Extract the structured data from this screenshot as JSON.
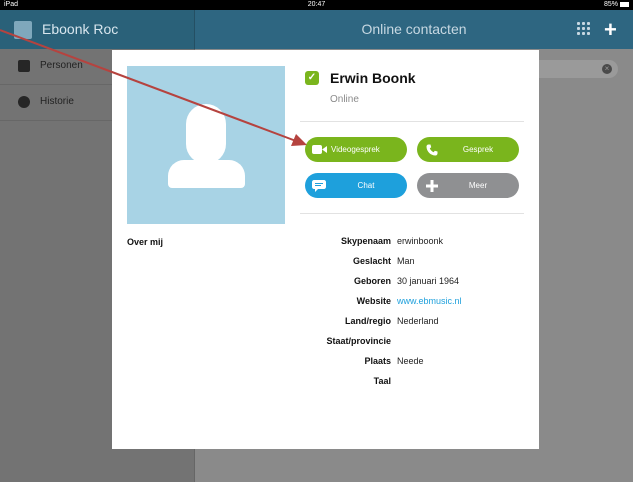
{
  "status_bar": {
    "device": "iPad",
    "time": "20:47",
    "battery": "85%"
  },
  "nav": {
    "user_name": "Eboonk Roc",
    "title": "Online contacten"
  },
  "sidebar": {
    "items": [
      {
        "label": "Personen",
        "icon": "contacts-icon"
      },
      {
        "label": "Historie",
        "icon": "history-clock-icon"
      }
    ]
  },
  "search": {
    "clear_icon": "×"
  },
  "contact": {
    "name": "Erwin Boonk",
    "status": "Online",
    "status_color": "#7ab51d",
    "about_label": "Over mij",
    "actions": {
      "video": "Videogesprek",
      "call": "Gesprek",
      "chat": "Chat",
      "more": "Meer"
    },
    "details": [
      {
        "label": "Skypenaam",
        "value": "erwinboonk"
      },
      {
        "label": "Geslacht",
        "value": "Man"
      },
      {
        "label": "Geboren",
        "value": "30 januari 1964"
      },
      {
        "label": "Website",
        "value": "www.ebmusic.nl"
      },
      {
        "label": "Land/regio",
        "value": "Nederland"
      },
      {
        "label": "Staat/provincie",
        "value": ""
      },
      {
        "label": "Plaats",
        "value": "Neede"
      },
      {
        "label": "Taal",
        "value": ""
      }
    ]
  },
  "colors": {
    "green": "#7ab51d",
    "blue": "#1ea0dc",
    "gray": "#8f9092",
    "nav": "#2e6681",
    "annotation_arrow": "#b5433f"
  }
}
